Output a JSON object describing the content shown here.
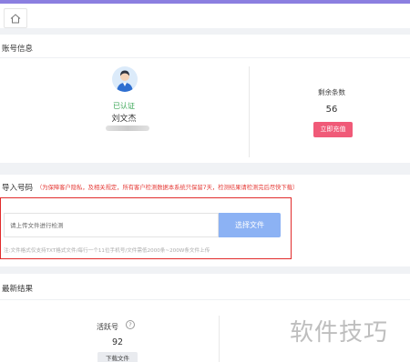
{
  "header": {
    "home_icon": "home-icon"
  },
  "account": {
    "section_title": "账号信息",
    "status": "已认证",
    "name": "刘文杰",
    "remaining_label": "剩余条数",
    "remaining_value": "56",
    "recharge_label": "立即充值"
  },
  "import": {
    "section_title": "导入号码",
    "notice": "（为保障客户隐私，及相关规定，所有客户检测数据本系统只保留7天，检测结果请检测完后尽快下载）",
    "input_placeholder": "请上传文件进行检测",
    "choose_file_label": "选择文件",
    "hint": "注:文件格式仅支持TXT格式文件/每行一个11位手机号/文件需低2000条~200W条文件上传"
  },
  "results": {
    "section_title": "最新结果",
    "active_label": "活跃号",
    "active_help": "?",
    "active_value": "92",
    "download_label": "下载文件"
  },
  "watermark": "软件技巧",
  "colors": {
    "accent_top": "#8b7fe0",
    "recharge_button": "#f05a78",
    "choose_button": "#8cb2f4",
    "highlight_frame": "#e12b2b",
    "verified": "#3aa655",
    "notice": "#e53935"
  }
}
